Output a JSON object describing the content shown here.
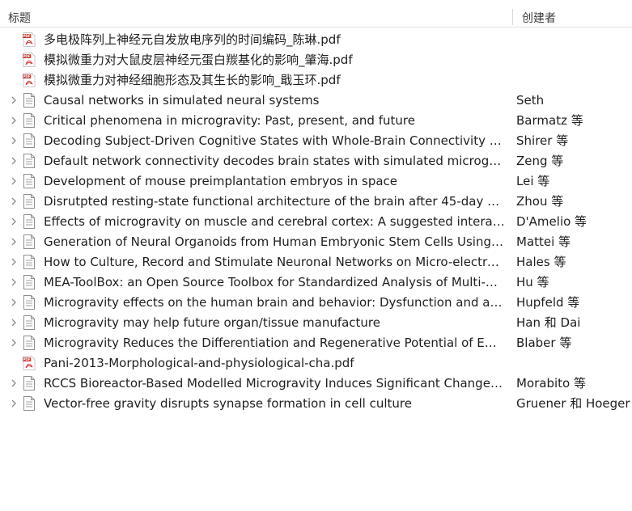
{
  "header": {
    "title_col": "标题",
    "creator_col": "创建者"
  },
  "rows": [
    {
      "expandable": false,
      "icon": "pdf-icon",
      "title": "多电极阵列上神经元自发放电序列的时间编码_陈琳.pdf",
      "creator": ""
    },
    {
      "expandable": false,
      "icon": "pdf-icon",
      "title": "模拟微重力对大鼠皮层神经元蛋白羰基化的影响_肇海.pdf",
      "creator": ""
    },
    {
      "expandable": false,
      "icon": "pdf-icon",
      "title": "模拟微重力对神经细胞形态及其生长的影响_戢玉环.pdf",
      "creator": ""
    },
    {
      "expandable": true,
      "icon": "document-icon",
      "title": "Causal networks in simulated neural systems",
      "creator": "Seth"
    },
    {
      "expandable": true,
      "icon": "document-icon",
      "title": "Critical phenomena in microgravity: Past, present, and future",
      "creator": "Barmatz 等"
    },
    {
      "expandable": true,
      "icon": "document-icon",
      "title": "Decoding Subject-Driven Cognitive States with Whole-Brain Connectivity Patt...",
      "creator": "Shirer 等"
    },
    {
      "expandable": true,
      "icon": "document-icon",
      "title": "Default network connectivity decodes brain states with simulated microgravity",
      "creator": "Zeng 等"
    },
    {
      "expandable": true,
      "icon": "document-icon",
      "title": "Development of mouse preimplantation embryos in space",
      "creator": "Lei 等"
    },
    {
      "expandable": true,
      "icon": "document-icon",
      "title": "Disrutpted resting-state functional architecture of the brain after 45-day simu...",
      "creator": "Zhou 等"
    },
    {
      "expandable": true,
      "icon": "document-icon",
      "title": "Effects of microgravity on muscle and cerebral cortex: A suggested interaction",
      "creator": "D'Amelio 等"
    },
    {
      "expandable": true,
      "icon": "document-icon",
      "title": "Generation of Neural Organoids from Human Embryonic Stem Cells Using th...",
      "creator": "Mattei 等"
    },
    {
      "expandable": true,
      "icon": "document-icon",
      "title": "How to Culture, Record and Stimulate Neuronal Networks on Micro-electrod...",
      "creator": "Hales 等"
    },
    {
      "expandable": true,
      "icon": "document-icon",
      "title": "MEA-ToolBox: an Open Source Toolbox for Standardized Analysis of Multi-El...",
      "creator": "Hu 等"
    },
    {
      "expandable": true,
      "icon": "document-icon",
      "title": "Microgravity effects on the human brain and behavior: Dysfunction and adap...",
      "creator": "Hupfeld 等"
    },
    {
      "expandable": true,
      "icon": "document-icon",
      "title": "Microgravity may help future organ/tissue manufacture",
      "creator": "Han 和 Dai"
    },
    {
      "expandable": true,
      "icon": "document-icon",
      "title": "Microgravity Reduces the Differentiation and Regenerative Potential of Embr...",
      "creator": "Blaber 等"
    },
    {
      "expandable": false,
      "icon": "pdf-icon",
      "title": "Pani-2013-Morphological-and-physiological-cha.pdf",
      "creator": ""
    },
    {
      "expandable": true,
      "icon": "document-icon",
      "title": "RCCS Bioreactor-Based Modelled Microgravity Induces Significant Changes o...",
      "creator": "Morabito 等"
    },
    {
      "expandable": true,
      "icon": "document-icon",
      "title": "Vector-free gravity disrupts synapse formation in cell culture",
      "creator": "Gruener 和 Hoeger"
    }
  ]
}
